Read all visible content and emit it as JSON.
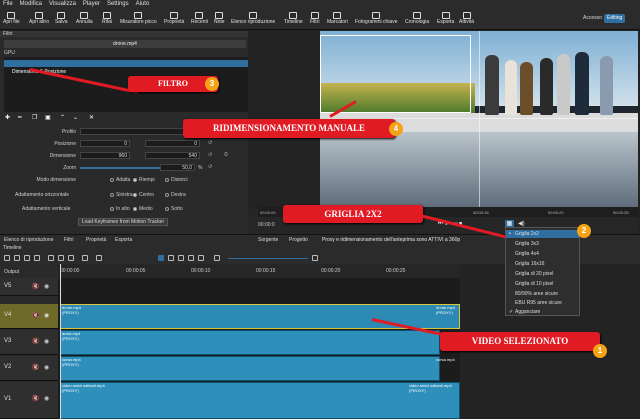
{
  "menu": [
    "File",
    "Modifica",
    "Visualizza",
    "Player",
    "Settings",
    "Aiuto"
  ],
  "toolbar": [
    "Apri file",
    "Apri altro",
    "Salva",
    "Annulla",
    "Rifai",
    "Misuratore picco",
    "Proprietà",
    "Recenti",
    "Note",
    "Elenco riproduzione",
    "Timeline",
    "Filtri",
    "Marcatori",
    "Fotogrammi chiave",
    "Cronologia",
    "Esporta",
    "Attività"
  ],
  "layout_tabs": {
    "accesso": "Accesso",
    "editing": "Editing"
  },
  "filters": {
    "title": "Filtri",
    "clip": "drone.mp4",
    "gpu": "GPU",
    "item": "Dimensione & Posizione",
    "profile_label": "Profilo",
    "posizione_label": "Posizione",
    "pos_x": "0",
    "pos_y": "0",
    "dimensione_label": "Dimensione",
    "dim_w": "960",
    "dim_h": "540",
    "zoom_label": "Zoom",
    "zoom_value": "50,0",
    "zoom_unit": "%",
    "modo_label": "Modo dimensione",
    "modo_opts": [
      "Adatta",
      "Riempi",
      "Distorci"
    ],
    "oriz_label": "Adattamento orizzontale",
    "oriz_opts": [
      "Sinistra",
      "Centro",
      "Destra"
    ],
    "vert_label": "Adattamento verticale",
    "vert_opts": [
      "In alto",
      "Medio",
      "Sotto"
    ],
    "load_kf": "Load Keyframes from Motion Tracker"
  },
  "bottom_tabs": [
    "Elenco di riproduzione",
    "Filtri",
    "Proprietà",
    "Esporta"
  ],
  "source_tabs": [
    "Sorgente",
    "Progetto"
  ],
  "status_text": "Proxy e ridimensionamento dell'anteprima sono ATTIVI a 360p",
  "preview_ruler": [
    "00:00:00",
    "00:00:15",
    "00:00:20",
    "00:00:25"
  ],
  "timecode": "00:00:0",
  "timeline": {
    "title": "Timeline",
    "output": "Output",
    "ruler": [
      "00:00:00",
      "00:00:05",
      "00:00:10",
      "00:00:15",
      "00:00:20",
      "00:00:25"
    ],
    "tracks": [
      "V5",
      "V4",
      "V3",
      "V2",
      "V1"
    ],
    "clips": {
      "v4a": "drone.mp4",
      "v4b": "drone.mp4",
      "v3a": "amici.mp4",
      "v3b": "amici.mp4",
      "v2a": "corsa.mp4",
      "v2b": "corsa.mp4",
      "v1a": "video amici saltanti.mp4",
      "v1b": "video amici saltanti.mp4",
      "proxy": "(PROXY)"
    }
  },
  "grid_menu": [
    "Griglia 2x2",
    "Griglia 3x3",
    "Griglia 4x4",
    "Griglia 16x16",
    "Griglia di 20 pixel",
    "Griglia di 10 pixel",
    "80/90% aree sicure",
    "EBU R95 aree sicure",
    "Agganciare"
  ],
  "callouts": {
    "filtro": "FILTRO",
    "filtro_n": "3",
    "ridim": "RIDIMENSIONAMENTO MANUALE",
    "ridim_n": "4",
    "griglia": "GRIGLIA 2X2",
    "griglia_n": "2",
    "video": "VIDEO SELEZIONATO",
    "video_n": "1"
  },
  "colors": {
    "accent": "#2f6fa0",
    "clip": "#2f8fbb",
    "callout": "#e01b24",
    "badge": "#f5a316",
    "editing": "#2f6fa0"
  }
}
